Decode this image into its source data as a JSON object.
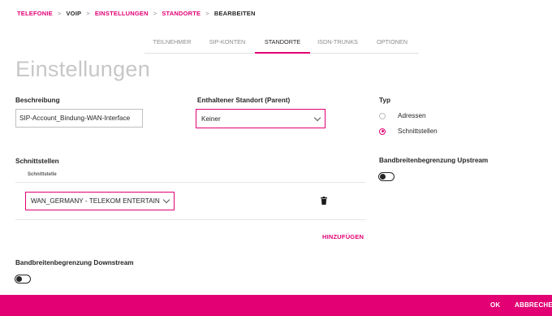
{
  "breadcrumb": {
    "items": [
      "TELEFONIE",
      "VOIP",
      "EINSTELLUNGEN",
      "STANDORTE",
      "BEARBEITEN"
    ],
    "separator": ">"
  },
  "tabs": [
    {
      "label": "TEILNEHMER",
      "active": false
    },
    {
      "label": "SIP-KONTEN",
      "active": false
    },
    {
      "label": "STANDORTE",
      "active": true
    },
    {
      "label": "ISDN-TRUNKS",
      "active": false
    },
    {
      "label": "OPTIONEN",
      "active": false
    }
  ],
  "page_title": "Einstellungen",
  "form": {
    "beschreibung": {
      "label": "Beschreibung",
      "value": "SIP-Account_Bindung-WAN-Interface"
    },
    "parent": {
      "label": "Enthaltener Standort (Parent)",
      "value": "Keiner"
    },
    "typ": {
      "label": "Typ",
      "options": [
        {
          "label": "Adressen",
          "checked": false
        },
        {
          "label": "Schnittstellen",
          "checked": true
        }
      ]
    },
    "schnittstellen": {
      "label": "Schnittstellen",
      "column_header": "Schnittstelle",
      "rows": [
        {
          "value": "WAN_GERMANY - TELEKOM ENTERTAIN"
        }
      ],
      "add_label": "HINZUFÜGEN"
    },
    "upstream": {
      "label": "Bandbreitenbegrenzung Upstream",
      "enabled": false
    },
    "downstream": {
      "label": "Bandbreitenbegrenzung Downstream",
      "enabled": false
    }
  },
  "footer": {
    "ok_label": "OK",
    "cancel_label": "ABBRECHEN"
  },
  "colors": {
    "accent": "#e20074",
    "footer_bg": "#e20074",
    "title": "#c7c7c7"
  },
  "icons": {
    "delete": "trash-icon",
    "dropdown": "chevron-down-icon"
  }
}
